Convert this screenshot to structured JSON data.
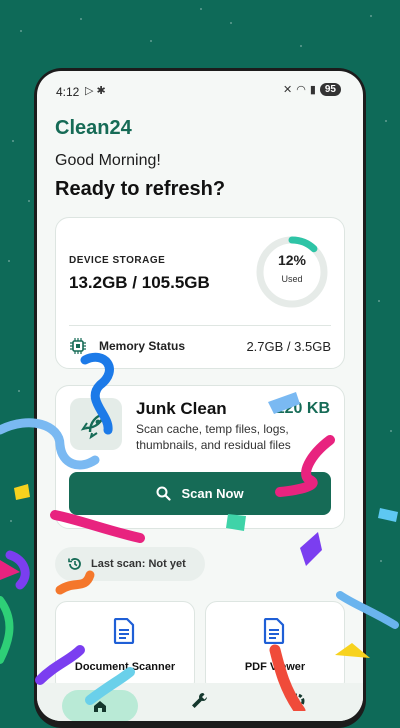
{
  "status_bar": {
    "time": "4:12",
    "battery": "95"
  },
  "app_title": "Clean24",
  "greeting": "Good Morning!",
  "headline": "Ready to refresh?",
  "storage": {
    "label": "DEVICE STORAGE",
    "value": "13.2GB / 105.5GB",
    "percent_text": "12%",
    "percent_used": 0.12,
    "used_label": "Used",
    "memory_label": "Memory Status",
    "memory_value": "2.7GB / 3.5GB"
  },
  "junk": {
    "title": "Junk Clean",
    "size": "120 KB",
    "description": "Scan cache, temp files, logs, thumbnails, and residual files",
    "button_label": "Scan Now"
  },
  "last_scan": "Last scan: Not yet",
  "tools": [
    {
      "label": "Document Scanner",
      "icon": "document-icon"
    },
    {
      "label": "PDF Viewer",
      "icon": "document-icon"
    }
  ],
  "nav": [
    {
      "icon": "home-icon",
      "active": true
    },
    {
      "icon": "wrench-icon",
      "active": false
    },
    {
      "icon": "gear-icon",
      "active": false
    }
  ],
  "colors": {
    "background": "#0e6a58",
    "brand": "#166b56",
    "ring_accent": "#2ec4a6",
    "active_nav": "#b9ead6"
  }
}
